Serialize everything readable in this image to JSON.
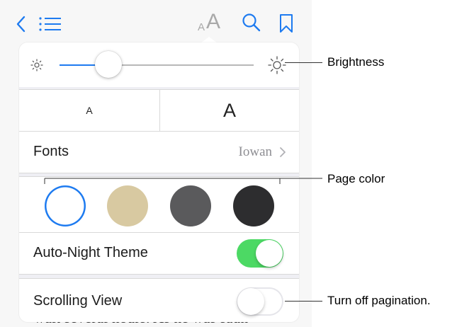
{
  "toolbar": {
    "font_size_small_glyph": "A",
    "font_size_large_glyph": "A",
    "icons": [
      "back-chevron-icon",
      "contents-list-icon",
      "text-size-icon",
      "search-icon",
      "bookmark-icon"
    ],
    "accent_color": "#1e7bf0"
  },
  "popover": {
    "brightness": {
      "level": 0.25,
      "min_icon": "sun-small-icon",
      "max_icon": "sun-large-icon"
    },
    "font_size": {
      "decrease_label": "A",
      "increase_label": "A"
    },
    "fonts": {
      "label": "Fonts",
      "value": "Iowan"
    },
    "page_colors": [
      {
        "name": "white",
        "color": "#ffffff",
        "selected": true
      },
      {
        "name": "sepia",
        "color": "#d8c9a1",
        "selected": false
      },
      {
        "name": "gray",
        "color": "#5a5a5c",
        "selected": false
      },
      {
        "name": "night",
        "color": "#2d2d2f",
        "selected": false
      }
    ],
    "auto_night_theme": {
      "label": "Auto-Night Theme",
      "on": true,
      "on_color": "#4cd964"
    },
    "scrolling_view": {
      "label": "Scrolling View",
      "on": false
    }
  },
  "background_text": "wait several hours. As he was saun-",
  "callouts": {
    "brightness": "Brightness",
    "page_color": "Page color",
    "pagination": "Turn off pagination."
  }
}
